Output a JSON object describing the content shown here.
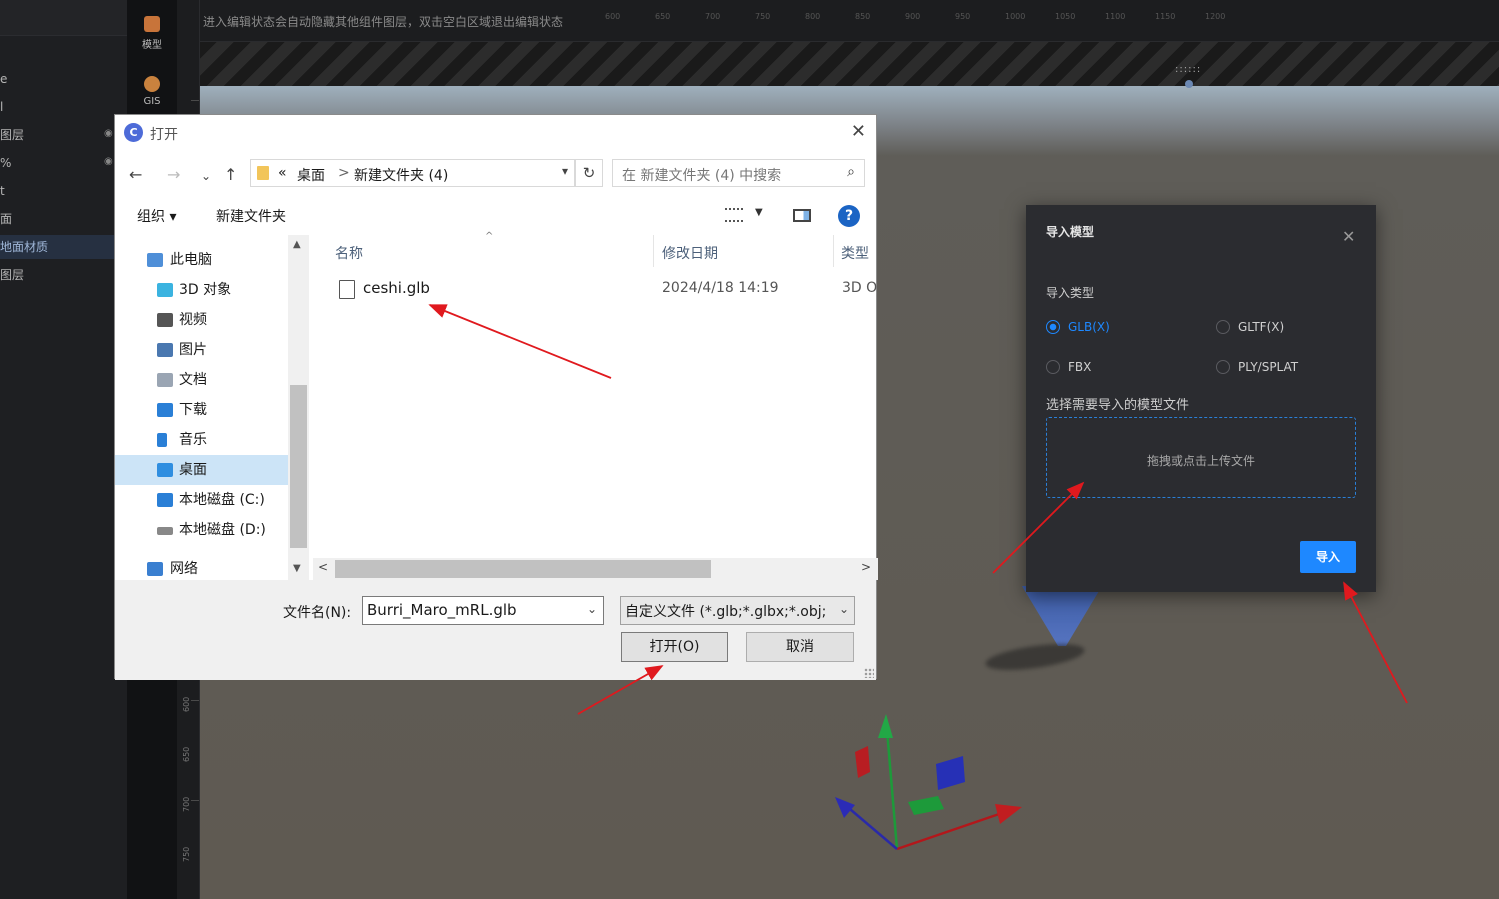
{
  "editor": {
    "hint": "进入编辑状态会自动隐藏其他组件图层，双击空白区域退出编辑状态",
    "icon_bar": [
      {
        "label": "模型",
        "icon": "model-icon",
        "color": "#d9803a"
      },
      {
        "label": "GIS",
        "icon": "globe-icon",
        "color": "#c9823e"
      }
    ],
    "left_items": [
      "e",
      "l",
      "图层",
      "%",
      "t",
      "面",
      "地面材质",
      "图层"
    ],
    "ruler_h_labels": [
      "600",
      "650",
      "700",
      "750",
      "800",
      "850",
      "900",
      "950",
      "1000",
      "1050",
      "1100",
      "1150",
      "1200"
    ],
    "ruler_v_labels": [
      "600",
      "650",
      "700",
      "750"
    ],
    "grip": "::::::"
  },
  "file_dialog": {
    "title": "打开",
    "app_icon": "C",
    "breadcrumb": {
      "prefix": "«",
      "items": [
        "桌面",
        "新建文件夹 (4)"
      ],
      "separator": ">"
    },
    "search_placeholder": "在 新建文件夹 (4) 中搜索",
    "toolbar": {
      "organize": "组织 ▾",
      "new_folder": "新建文件夹",
      "help": "?"
    },
    "tree": [
      {
        "label": "此电脑",
        "icon": "computer-icon",
        "color": "#4f8fd8",
        "indent": 1
      },
      {
        "label": "3D 对象",
        "icon": "3d-objects-icon",
        "color": "#3bb3e0",
        "indent": 2
      },
      {
        "label": "视频",
        "icon": "video-icon",
        "color": "#555",
        "indent": 2
      },
      {
        "label": "图片",
        "icon": "pictures-icon",
        "color": "#4a78b0",
        "indent": 2
      },
      {
        "label": "文档",
        "icon": "documents-icon",
        "color": "#9aa5b3",
        "indent": 2
      },
      {
        "label": "下载",
        "icon": "downloads-icon",
        "color": "#2a7fd6",
        "indent": 2
      },
      {
        "label": "音乐",
        "icon": "music-icon",
        "color": "#2a7fd6",
        "indent": 2
      },
      {
        "label": "桌面",
        "icon": "desktop-icon",
        "color": "#2f8ee0",
        "indent": 2,
        "selected": true
      },
      {
        "label": "本地磁盘 (C:)",
        "icon": "drive-c-icon",
        "color": "#2a7fd6",
        "indent": 2
      },
      {
        "label": "本地磁盘 (D:)",
        "icon": "drive-d-icon",
        "color": "#888",
        "indent": 2
      },
      {
        "label": "网络",
        "icon": "network-icon",
        "color": "#3a7fd0",
        "indent": 1
      }
    ],
    "columns": {
      "name": "名称",
      "modified": "修改日期",
      "type": "类型"
    },
    "files": [
      {
        "name": "ceshi.glb",
        "modified": "2024/4/18 14:19",
        "type": "3D O"
      }
    ],
    "filename_label": "文件名(N):",
    "filename_value": "Burri_Maro_mRL.glb",
    "filetype": "自定义文件 (*.glb;*.glbx;*.obj;",
    "open_button": "打开(O)",
    "cancel_button": "取消",
    "close_glyph": "✕"
  },
  "import_dialog": {
    "title": "导入模型",
    "close_glyph": "✕",
    "type_label": "导入类型",
    "types": [
      {
        "label": "GLB(X)",
        "checked": true
      },
      {
        "label": "GLTF(X)",
        "checked": false
      },
      {
        "label": "FBX",
        "checked": false
      },
      {
        "label": "PLY/SPLAT",
        "checked": false
      }
    ],
    "file_label": "选择需要导入的模型文件",
    "upload_text": "拖拽或点击上传文件",
    "import_button": "导入"
  },
  "colors": {
    "accent": "#1e88ff",
    "arrow": "#e0191e"
  }
}
